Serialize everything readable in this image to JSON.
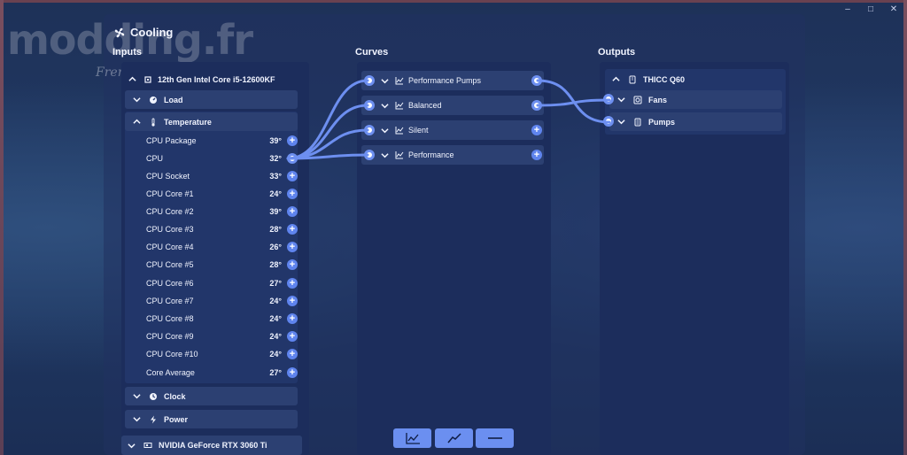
{
  "window_controls": {
    "minimize": "–",
    "maximize": "□",
    "close": "✕"
  },
  "watermark": {
    "brand": "modding.fr",
    "signature": "FrenchMod"
  },
  "app": {
    "title": "Cooling"
  },
  "columns": {
    "inputs": "Inputs",
    "curves": "Curves",
    "outputs": "Outputs"
  },
  "inputs": {
    "device": "12th Gen Intel Core i5-12600KF",
    "groups": {
      "load": "Load",
      "temperature": "Temperature",
      "clock": "Clock",
      "power": "Power"
    },
    "sensors": [
      {
        "name": "CPU Package",
        "value": "39°"
      },
      {
        "name": "CPU",
        "value": "32°"
      },
      {
        "name": "CPU Socket",
        "value": "33°"
      },
      {
        "name": "CPU Core #1",
        "value": "24°"
      },
      {
        "name": "CPU Core #2",
        "value": "39°"
      },
      {
        "name": "CPU Core #3",
        "value": "28°"
      },
      {
        "name": "CPU Core #4",
        "value": "26°"
      },
      {
        "name": "CPU Core #5",
        "value": "28°"
      },
      {
        "name": "CPU Core #6",
        "value": "27°"
      },
      {
        "name": "CPU Core #7",
        "value": "24°"
      },
      {
        "name": "CPU Core #8",
        "value": "24°"
      },
      {
        "name": "CPU Core #9",
        "value": "24°"
      },
      {
        "name": "CPU Core #10",
        "value": "24°"
      },
      {
        "name": "Core Average",
        "value": "27°"
      }
    ],
    "gpu": "NVIDIA GeForce RTX 3060 Ti"
  },
  "curves": [
    {
      "name": "Performance Pumps"
    },
    {
      "name": "Balanced"
    },
    {
      "name": "Silent"
    },
    {
      "name": "Performance"
    }
  ],
  "outputs": {
    "device": "THICC Q60",
    "channels": [
      {
        "name": "Fans"
      },
      {
        "name": "Pumps"
      }
    ]
  },
  "toolbar": {
    "buttons": [
      "graph-curve",
      "linear-curve",
      "fixed-curve"
    ]
  },
  "colors": {
    "accent": "#6b8ff0",
    "link": "#6d8ff0",
    "panel": "#1c2d5c",
    "row": "#2c4072"
  }
}
